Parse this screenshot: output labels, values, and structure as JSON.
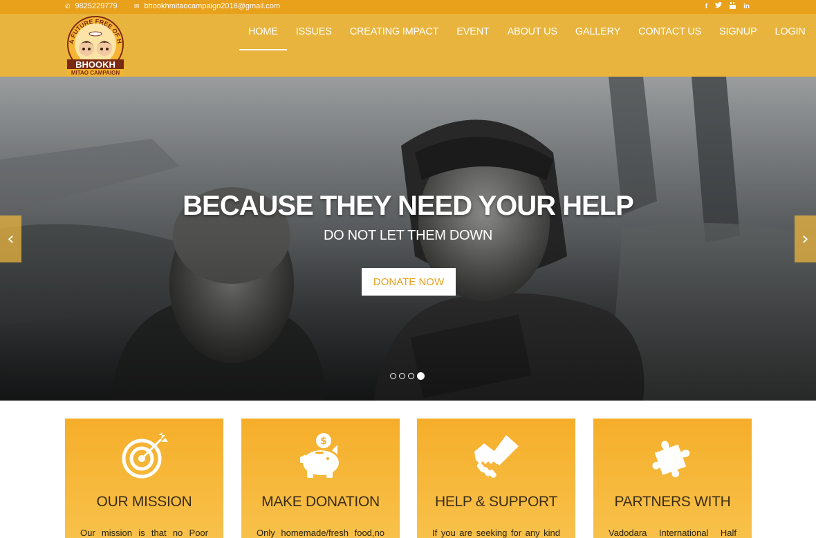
{
  "topbar": {
    "phone": "9825229779",
    "email": "bhookhmitaocampaign2018@gmail.com",
    "social": [
      "f",
      "t",
      "yt",
      "in"
    ]
  },
  "logo": {
    "arc_text": "A FUTURE FREE OF HUNGER",
    "name": "BHOOKH",
    "tagline": "MITAO CAMPAIGN"
  },
  "nav": [
    {
      "label": "HOME",
      "active": true
    },
    {
      "label": "ISSUES"
    },
    {
      "label": "CREATING IMPACT"
    },
    {
      "label": "EVENT"
    },
    {
      "label": "ABOUT US"
    },
    {
      "label": "GALLERY"
    },
    {
      "label": "CONTACT US"
    },
    {
      "label": "SIGNUP"
    },
    {
      "label": "LOGIN"
    }
  ],
  "hero": {
    "title": "BECAUSE THEY NEED YOUR HELP",
    "subtitle": "DO NOT LET THEM DOWN",
    "cta": "DONATE NOW",
    "prev_arrow": "‹",
    "next_arrow": "›",
    "slide_count": 4,
    "active_slide": 4
  },
  "cards": [
    {
      "title": "OUR MISSION",
      "text": "Our mission is that no Poor",
      "icon": "target-icon"
    },
    {
      "title": "MAKE DONATION",
      "text": "Only homemade/fresh food,no",
      "icon": "piggy-bank-icon"
    },
    {
      "title": "HELP & SUPPORT",
      "text": "If you are seeking for any kind",
      "icon": "handshake-icon"
    },
    {
      "title": "PARTNERS WITH",
      "text": "Vadodara International Half",
      "icon": "puzzle-icon"
    }
  ],
  "colors": {
    "topbar": "#e9a01b",
    "header": "#e9b43d",
    "accent": "#e9a01b",
    "card": "#f5ae2a"
  }
}
